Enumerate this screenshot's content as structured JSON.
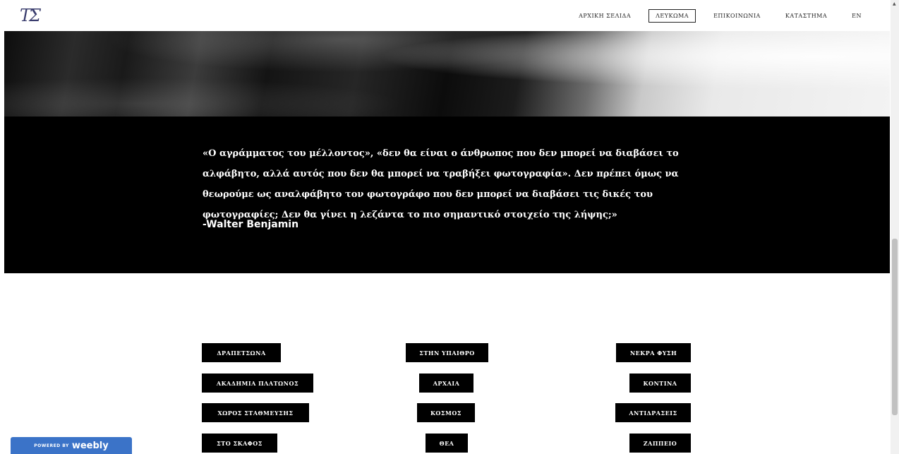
{
  "header": {
    "logo_text": "ΤΣ",
    "nav": [
      {
        "label": "ΑΡΧΙΚΗ ΣΕΛΙΔΑ",
        "active": false
      },
      {
        "label": "ΛΕΥΚΩΜΑ",
        "active": true
      },
      {
        "label": "ΕΠΙΚΟΙΝΩΝΙΑ",
        "active": false
      },
      {
        "label": "ΚΑΤΑΣΤΗΜΑ",
        "active": false
      },
      {
        "label": "EN",
        "active": false
      }
    ]
  },
  "quote": {
    "text": "«Ο αγράμματος του μέλλοντος», «δεν θα είναι ο άνθρωπος που δεν μπορεί να διαβάσει το αλφάβητο, αλλά αυτός που δεν θα μπορεί να τραβήξει φωτογραφία». Δεν πρέπει όμως να θεωρούμε ως αναλφάβητο τον φωτογράφο που δεν μπορεί να διαβάσει τις δικές του φωτογραφίες; Δεν θα γίνει η λεζάντα το πιο σημαντικό στοιχείο της λήψης;»",
    "author": "-Walter Benjamin"
  },
  "albums": {
    "column_1": [
      "ΔΡΑΠΕΤΣΩΝΑ",
      "ΑΚΑΔΗΜΙΑ ΠΛΑΤΩΝΟΣ",
      "ΧΩΡΟΣ ΣΤΑΘΜΕΥΣΗΣ",
      "ΣΤΟ ΣΚΑΦΟΣ"
    ],
    "column_2": [
      "ΣΤΗΝ ΥΠΑΙΘΡΟ",
      "ΑΡΧΑΙΑ",
      "ΚΟΣΜΟΣ",
      "ΘΕΑ"
    ],
    "column_3": [
      "ΝΕΚΡΑ ΦΥΣΗ",
      "ΚΟΝΤΙΝΑ",
      "ΑΝΤΙΔΡΑΣΕΙΣ",
      "ΖΑΠΠΕΙΟ"
    ]
  },
  "badge": {
    "powered_by": "POWERED BY",
    "brand": "weebly"
  },
  "colors": {
    "band": "#000000",
    "badge": "#3b73c8",
    "logo": "#3a3d6e"
  }
}
